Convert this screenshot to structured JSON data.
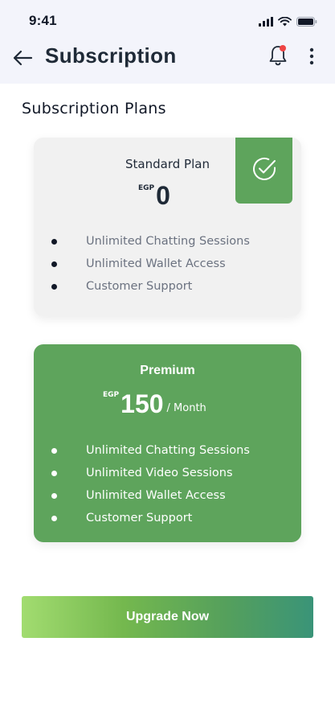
{
  "status_bar": {
    "time": "9:41",
    "icons": [
      "signal-icon",
      "wifi-icon",
      "battery-icon"
    ]
  },
  "header": {
    "title": "Subscription",
    "back_icon": "arrow-left-icon",
    "bell_icon": "bell-icon",
    "more_icon": "more-vertical-icon"
  },
  "section_title": "Subscription Plans",
  "plans": [
    {
      "name": "Standard Plan",
      "currency": "EGP",
      "price": "0",
      "period": "",
      "selected": true,
      "features": [
        "Unlimited Chatting Sessions",
        "Unlimited Wallet Access",
        "Customer Support"
      ]
    },
    {
      "name": "Premium",
      "currency": "EGP",
      "price": "150",
      "period": "/ Month",
      "selected": false,
      "features": [
        "Unlimited Chatting Sessions",
        "Unlimited Video Sessions",
        "Unlimited Wallet Access",
        "Customer Support"
      ]
    }
  ],
  "cta": {
    "label": "Upgrade Now"
  },
  "colors": {
    "primary_green": "#5ea45c",
    "header_bg": "#f3f4fb",
    "card_bg": "#f1f1f1",
    "notification_dot": "#ef4444",
    "gradient_start": "#a2dc70",
    "gradient_end": "#3a9478"
  }
}
